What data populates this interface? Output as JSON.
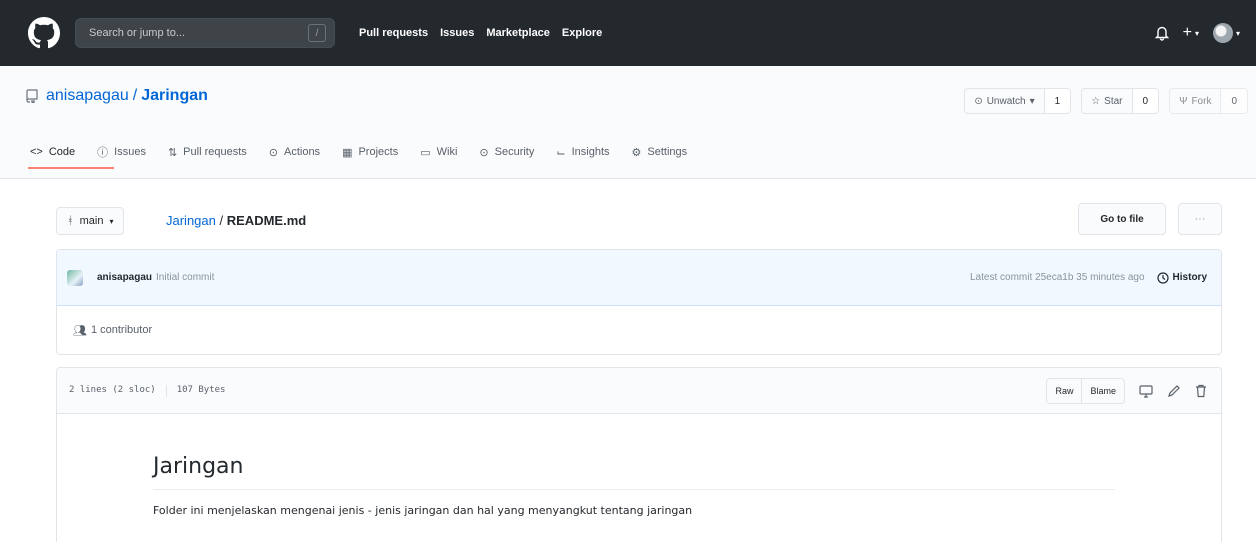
{
  "header": {
    "search_placeholder": "Search or jump to...",
    "search_shortcut": "/",
    "nav": [
      "Pull requests",
      "Issues",
      "Marketplace",
      "Explore"
    ]
  },
  "repo": {
    "owner": "anisapagau",
    "separator": "/",
    "name": "Jaringan",
    "watch_label": "Unwatch",
    "watch_count": "1",
    "star_label": "Star",
    "star_count": "0",
    "fork_label": "Fork",
    "fork_count": "0"
  },
  "tabs": [
    {
      "label": "Code",
      "icon": "code-icon"
    },
    {
      "label": "Issues",
      "icon": "issue-icon"
    },
    {
      "label": "Pull requests",
      "icon": "pull-request-icon"
    },
    {
      "label": "Actions",
      "icon": "actions-icon"
    },
    {
      "label": "Projects",
      "icon": "projects-icon"
    },
    {
      "label": "Wiki",
      "icon": "wiki-icon"
    },
    {
      "label": "Security",
      "icon": "security-icon"
    },
    {
      "label": "Insights",
      "icon": "insights-icon"
    },
    {
      "label": "Settings",
      "icon": "settings-icon"
    }
  ],
  "breadcrumb": {
    "branch": "main",
    "repo_link": "Jaringan",
    "separator": "/",
    "file": "README.md",
    "go_to_file": "Go to file",
    "more": "···"
  },
  "commit": {
    "author": "anisapagau",
    "message": "Initial commit",
    "latest": "Latest commit 25eca1b 35 minutes ago",
    "history": "History",
    "contributors": "1 contributor"
  },
  "file": {
    "lines": "2 lines (2 sloc)",
    "size": "107 Bytes",
    "raw": "Raw",
    "blame": "Blame"
  },
  "readme": {
    "heading": "Jaringan",
    "paragraph": "Folder ini menjelaskan mengenai jenis - jenis jaringan dan hal yang menyangkut tentang jaringan"
  },
  "colors": {
    "header_bg": "#24292e",
    "link": "#0366d6",
    "tab_accent": "#f9826c",
    "commit_bg": "#f1f8ff"
  }
}
